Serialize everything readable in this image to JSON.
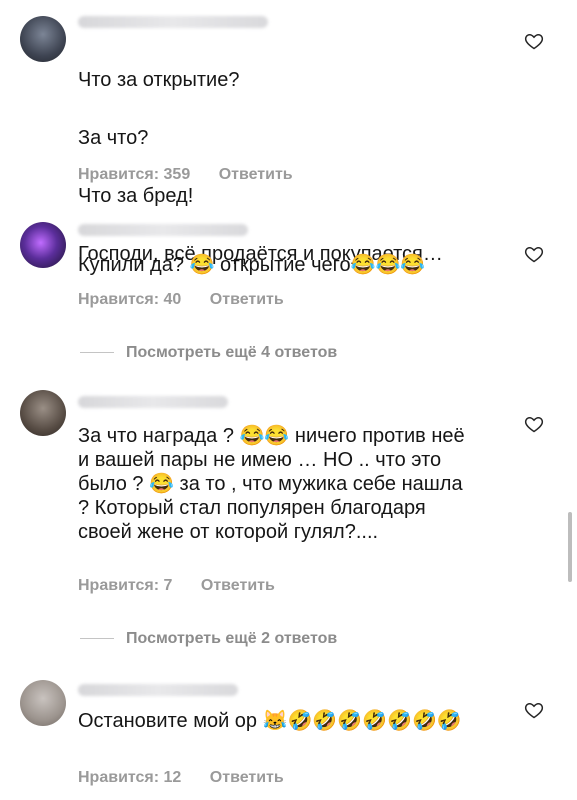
{
  "comments": [
    {
      "lines": [
        "Что за открытие?",
        "За что?",
        "Что за бред!",
        "Господи, всё продаётся и покупается…"
      ],
      "likes": "Нравится: 359",
      "reply_label": "Ответить"
    },
    {
      "text": "Купили да? 😂 открытие чего😂😂😂",
      "likes": "Нравится: 40",
      "reply_label": "Ответить"
    },
    {
      "text": "За что награда ? 😂😂 ничего против неё и вашей пары не имею … НО .. что это было ? 😂 за то , что мужика себе нашла ? Который стал популярен благодаря своей жене от которой гулял?....",
      "likes": "Нравится: 7",
      "reply_label": "Ответить"
    },
    {
      "text": "Остановите мой ор 😹🤣🤣🤣🤣🤣🤣🤣",
      "likes": "Нравится: 12",
      "reply_label": "Ответить"
    }
  ],
  "view_more": [
    "Посмотреть ещё 4 ответов",
    "Посмотреть ещё 2 ответов"
  ],
  "icons": {
    "like": "heart-outline-icon"
  }
}
